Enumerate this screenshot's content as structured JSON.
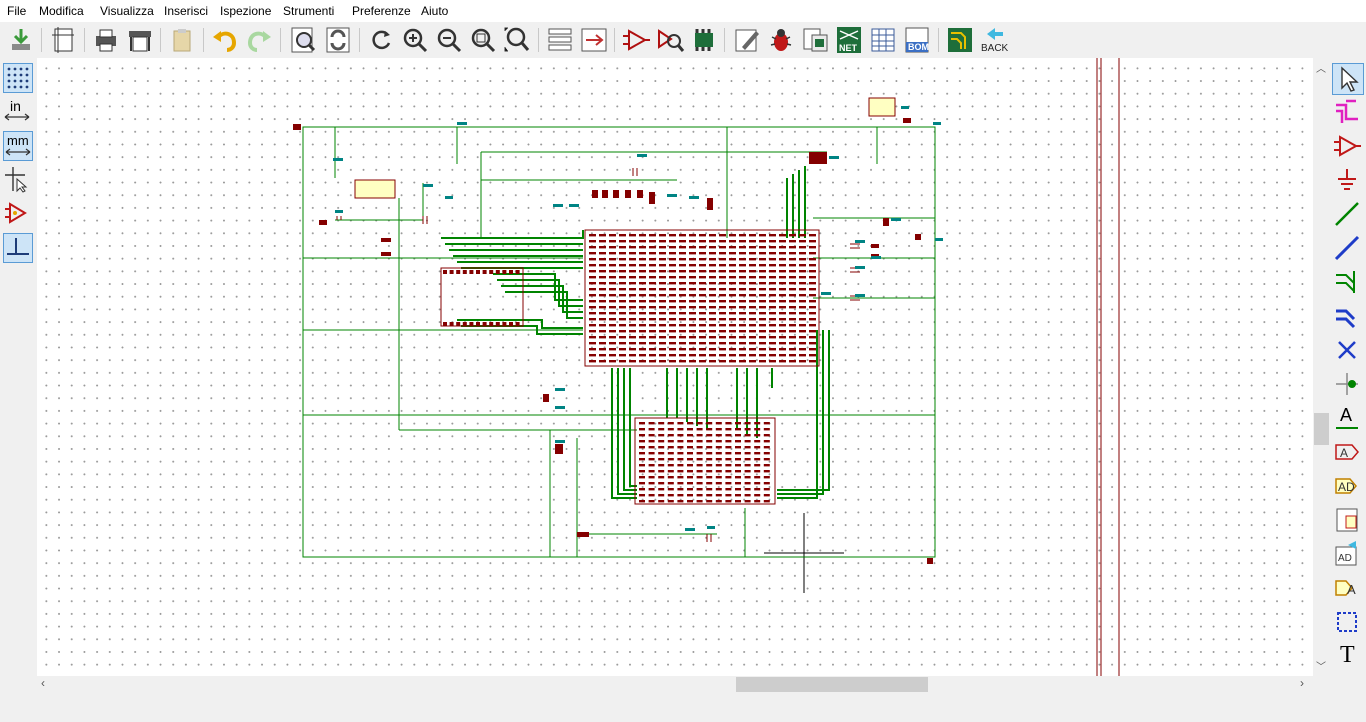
{
  "menu": {
    "file": "File",
    "modifica": "Modifica",
    "visualizza": "Visualizza",
    "inserisci": "Inserisci",
    "ispezione": "Ispezione",
    "strumenti": "Strumenti",
    "preferenze": "Preferenze",
    "aiuto": "Aiuto"
  },
  "toolbar": {
    "net_label": "NET",
    "bom_label": "BOM",
    "back_label": "BACK"
  },
  "left_toolbar": {
    "units_in": "in",
    "units_mm": "mm"
  },
  "right_toolbar": {
    "text_glyph": "T",
    "label_glyph": "A"
  },
  "colors": {
    "wire": "#008400",
    "component": "#840000",
    "component_fill": "#ffffc2",
    "accent": "#5a9bd5",
    "grid": "#9a9a9a"
  },
  "icons": [
    "save-icon",
    "page-settings-icon",
    "print-icon",
    "plot-icon",
    "paste-icon",
    "undo-icon",
    "redo-icon",
    "find-icon",
    "find-replace-icon",
    "refresh-icon",
    "zoom-in-icon",
    "zoom-out-icon",
    "zoom-fit-icon",
    "zoom-selection-icon",
    "hierarchy-navigator-icon",
    "leave-sheet-icon",
    "symbol-editor-icon",
    "symbol-browser-icon",
    "footprint-assign-icon",
    "annotate-icon",
    "erc-icon",
    "bus-definitions-icon",
    "netlist-icon",
    "field-editor-icon",
    "bom-icon",
    "pcbnew-icon",
    "back-annotate-icon"
  ]
}
